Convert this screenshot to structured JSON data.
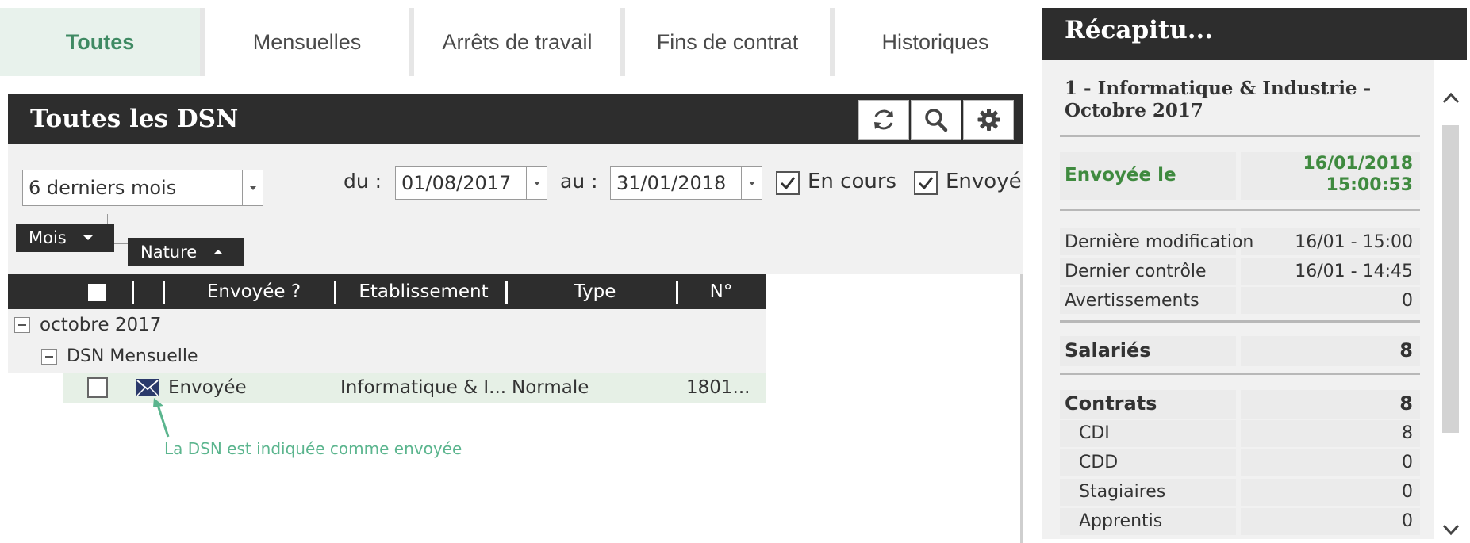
{
  "tabs": [
    {
      "label": "Toutes"
    },
    {
      "label": "Mensuelles"
    },
    {
      "label": "Arrêts de travail"
    },
    {
      "label": "Fins de contrat"
    },
    {
      "label": "Historiques"
    }
  ],
  "left_panel": {
    "title": "Toutes les DSN",
    "toolbar_icons": [
      "refresh-icon",
      "search-icon",
      "gear-icon"
    ]
  },
  "filters": {
    "period": "6 derniers mois",
    "from_label": "du :",
    "from_date": "01/08/2017",
    "to_label": "au :",
    "to_date": "31/01/2018",
    "checkboxes": [
      {
        "label": "En cours",
        "checked": true
      },
      {
        "label": "Envoyée",
        "checked": true
      }
    ]
  },
  "group_by": [
    {
      "label": "Mois",
      "sort": "desc"
    },
    {
      "label": "Nature",
      "sort": "asc"
    }
  ],
  "grid": {
    "columns": [
      "Envoyée ?",
      "Etablissement",
      "Type",
      "N°"
    ],
    "groups": [
      {
        "label": "octobre 2017",
        "subgroups": [
          {
            "label": "DSN Mensuelle",
            "rows": [
              {
                "sent": "Envoyée",
                "establishment": "Informatique & I...",
                "type": "Normale",
                "number": "1801..."
              }
            ]
          }
        ]
      }
    ]
  },
  "annotation": "La DSN est indiquée comme envoyée",
  "recap": {
    "title": "Récapitu...",
    "period": "1 - Informatique & Industrie - Octobre 2017",
    "sent_label": "Envoyée le",
    "sent_date": "16/01/2018",
    "sent_time": "15:00:53",
    "details": [
      {
        "label": "Dernière modification",
        "value": "16/01 - 15:00"
      },
      {
        "label": "Dernier contrôle",
        "value": "16/01 - 14:45"
      },
      {
        "label": "Avertissements",
        "value": "0"
      }
    ],
    "salaries": {
      "label": "Salariés",
      "value": "8"
    },
    "contrats": {
      "label": "Contrats",
      "value": "8",
      "items": [
        {
          "label": "CDI",
          "value": "8"
        },
        {
          "label": "CDD",
          "value": "0"
        },
        {
          "label": "Stagiaires",
          "value": "0"
        },
        {
          "label": "Apprentis",
          "value": "0"
        }
      ]
    }
  },
  "colors": {
    "accent_green": "#3f8a63",
    "header_dark": "#2d2d2d",
    "annotation_green": "#5bb58e"
  }
}
